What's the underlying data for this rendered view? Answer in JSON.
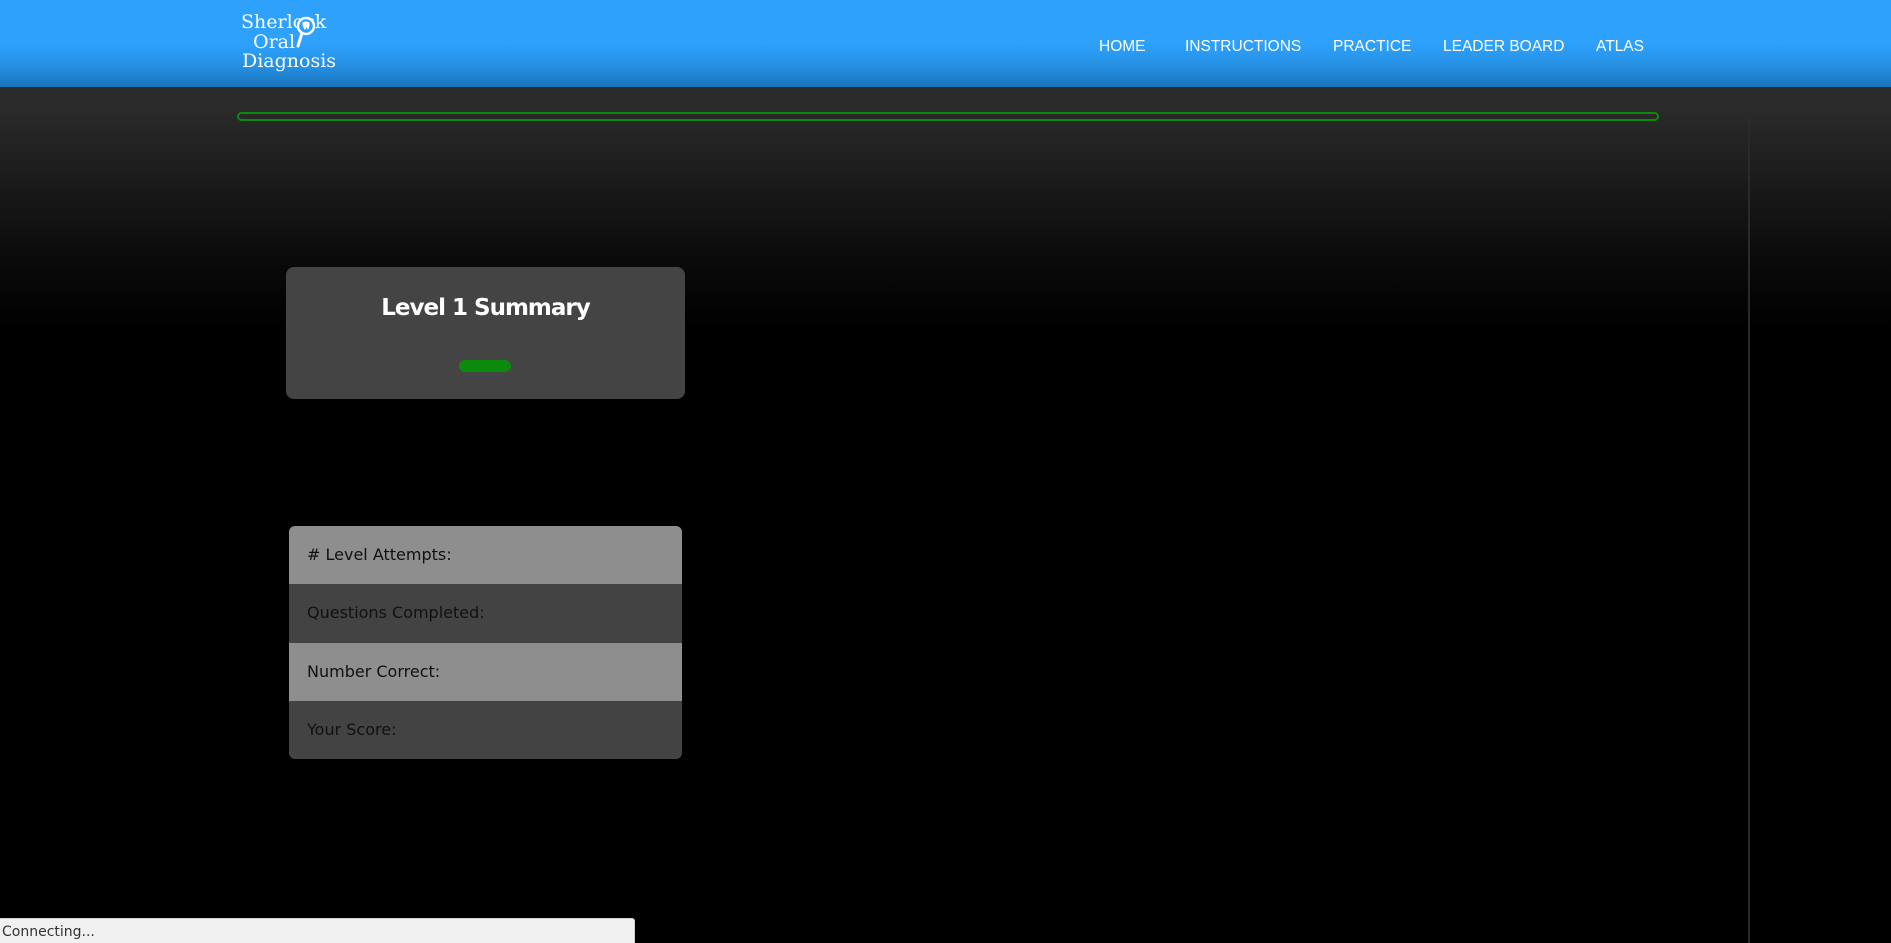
{
  "header": {
    "logo": {
      "line1": "Sherlock",
      "line2": "Oral",
      "line3": "Diagnosis"
    },
    "nav": [
      {
        "label": "HOME"
      },
      {
        "label": "INSTRUCTIONS"
      },
      {
        "label": "PRACTICE"
      },
      {
        "label": "LEADER BOARD"
      },
      {
        "label": "ATLAS"
      }
    ]
  },
  "progress": {
    "color": "#0b8a0b",
    "fraction": 0
  },
  "summary": {
    "title": "Level 1 Summary"
  },
  "stats": [
    {
      "label": "# Level Attempts:",
      "value": ""
    },
    {
      "label": "Questions Completed:",
      "value": ""
    },
    {
      "label": "Number Correct:",
      "value": ""
    },
    {
      "label": "Your Score:",
      "value": ""
    }
  ],
  "status_bar": {
    "text": "Connecting..."
  },
  "colors": {
    "header_blue": "#2ea1fd",
    "accent_green": "#0b8a0b"
  }
}
